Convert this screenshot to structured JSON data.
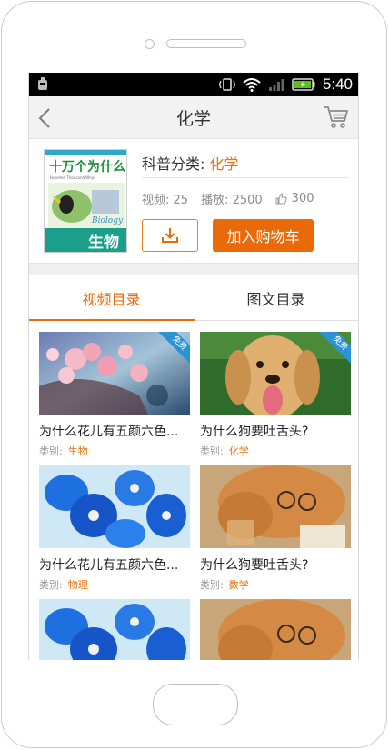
{
  "status_bar": {
    "time": "5:40"
  },
  "header": {
    "title": "化学"
  },
  "book": {
    "category_label": "科普分类: ",
    "category_value": "化学",
    "views_label": "视频: 25",
    "plays_label": "播放: 2500",
    "likes": "300",
    "add_to_cart_label": "加入购物车",
    "cover": {
      "title": "十万个为什么",
      "subtitle": "Hundred Thousand Whys",
      "subject": "生物",
      "subject_en": "Biology"
    }
  },
  "tabs": [
    {
      "label": "视频目录",
      "active": true
    },
    {
      "label": "图文目录",
      "active": false
    }
  ],
  "cards": [
    {
      "title": "为什么花儿有五颜六色...",
      "category_label": "类别:",
      "category_value": "生物",
      "free": "免费",
      "image": "pink-flowers"
    },
    {
      "title": "为什么狗要吐舌头?",
      "category_label": "类别:",
      "category_value": "化学",
      "free": "免费",
      "image": "dog-tongue"
    },
    {
      "title": "为什么花儿有五颜六色...",
      "category_label": "类别:",
      "category_value": "物理",
      "free": "",
      "image": "blue-orchid"
    },
    {
      "title": "为什么狗要吐舌头?",
      "category_label": "类别:",
      "category_value": "数学",
      "free": "",
      "image": "dog-glasses"
    },
    {
      "title": "",
      "category_label": "",
      "category_value": "",
      "free": "",
      "image": "blue-orchid"
    },
    {
      "title": "",
      "category_label": "",
      "category_value": "",
      "free": "",
      "image": "dog-glasses"
    }
  ],
  "colors": {
    "accent": "#ea6a0a",
    "free_badge": "#2b93d3"
  }
}
